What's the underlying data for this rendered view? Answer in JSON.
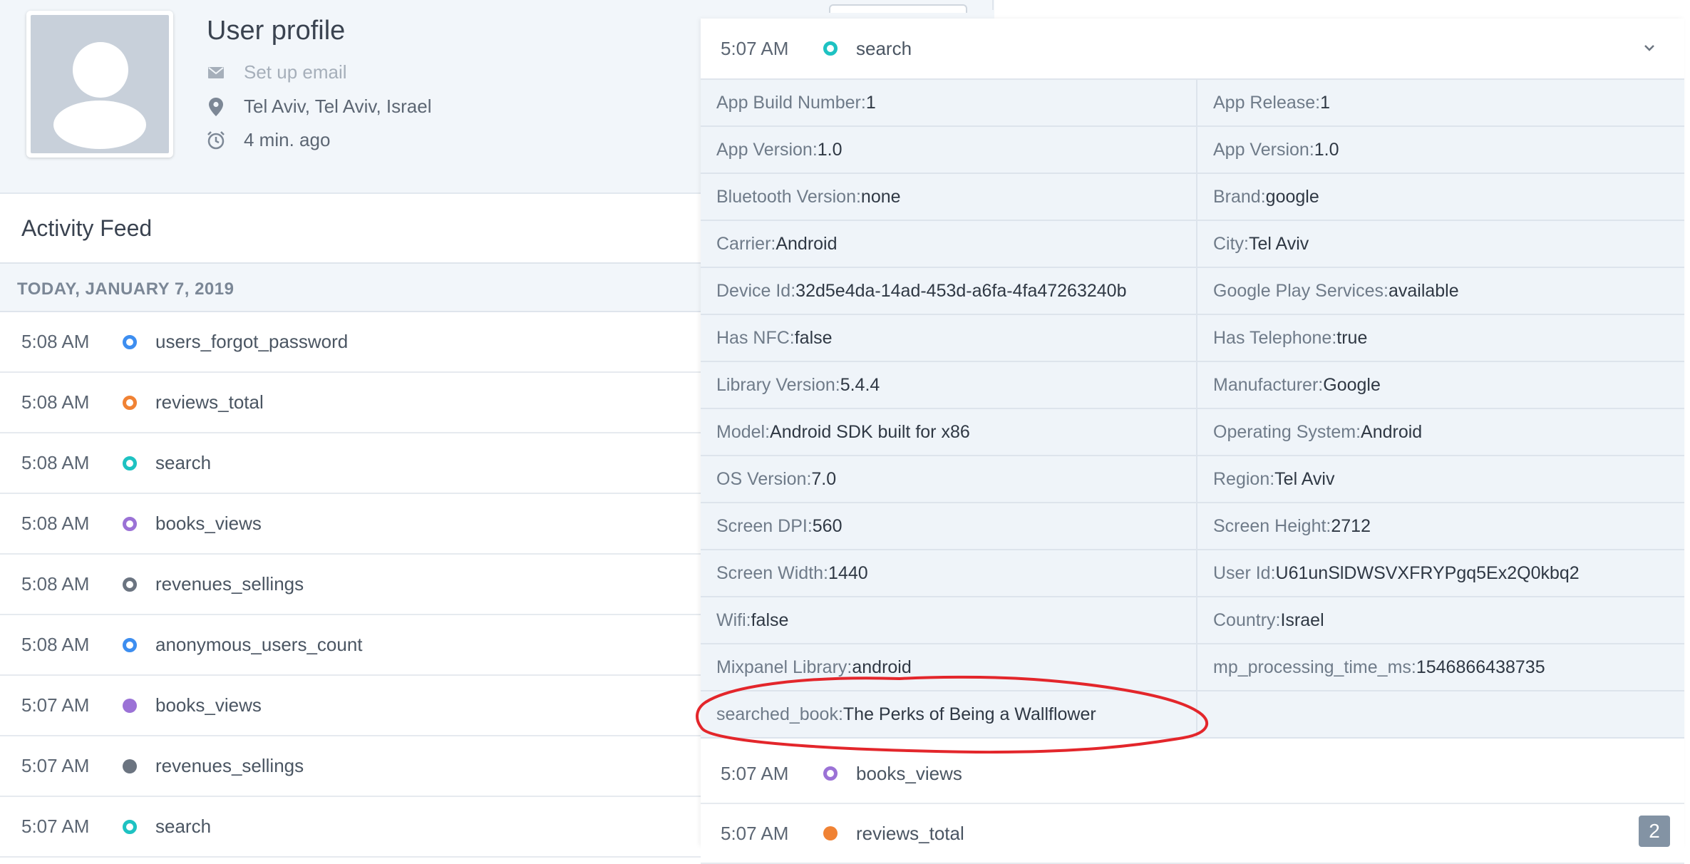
{
  "profile": {
    "title": "User profile",
    "email": "Set up email",
    "location": "Tel Aviv, Tel Aviv, Israel",
    "last_seen": "4 min. ago"
  },
  "feed": {
    "title": "Activity Feed",
    "date": "TODAY, JANUARY 7, 2019",
    "items": [
      {
        "time": "5:08 AM",
        "name": "users_forgot_password",
        "color": "#3d8ef0",
        "ring": true
      },
      {
        "time": "5:08 AM",
        "name": "reviews_total",
        "color": "#f08234",
        "ring": true
      },
      {
        "time": "5:08 AM",
        "name": "search",
        "color": "#1ec2c2",
        "ring": true
      },
      {
        "time": "5:08 AM",
        "name": "books_views",
        "color": "#9b72d6",
        "ring": true
      },
      {
        "time": "5:08 AM",
        "name": "revenues_sellings",
        "color": "#6b7480",
        "ring": true
      },
      {
        "time": "5:08 AM",
        "name": "anonymous_users_count",
        "color": "#3d8ef0",
        "ring": true
      },
      {
        "time": "5:07 AM",
        "name": "books_views",
        "color": "#9b72d6",
        "ring": false
      },
      {
        "time": "5:07 AM",
        "name": "revenues_sellings",
        "color": "#6b7480",
        "ring": false
      },
      {
        "time": "5:07 AM",
        "name": "search",
        "color": "#1ec2c2",
        "ring": true
      }
    ]
  },
  "detail": {
    "header": {
      "time": "5:07 AM",
      "name": "search",
      "color": "#1ec2c2"
    },
    "rows": [
      [
        {
          "k": "App Build Number: ",
          "v": "1"
        },
        {
          "k": "App Release: ",
          "v": "1"
        }
      ],
      [
        {
          "k": "App Version: ",
          "v": "1.0"
        },
        {
          "k": "App Version: ",
          "v": "1.0"
        }
      ],
      [
        {
          "k": "Bluetooth Version: ",
          "v": "none"
        },
        {
          "k": "Brand: ",
          "v": "google"
        }
      ],
      [
        {
          "k": "Carrier: ",
          "v": "Android"
        },
        {
          "k": "City: ",
          "v": "Tel Aviv"
        }
      ],
      [
        {
          "k": "Device Id: ",
          "v": "32d5e4da-14ad-453d-a6fa-4fa47263240b"
        },
        {
          "k": "Google Play Services: ",
          "v": "available"
        }
      ],
      [
        {
          "k": "Has NFC: ",
          "v": "false"
        },
        {
          "k": "Has Telephone: ",
          "v": "true"
        }
      ],
      [
        {
          "k": "Library Version: ",
          "v": "5.4.4"
        },
        {
          "k": "Manufacturer: ",
          "v": "Google"
        }
      ],
      [
        {
          "k": "Model: ",
          "v": "Android SDK built for x86"
        },
        {
          "k": "Operating System: ",
          "v": "Android"
        }
      ],
      [
        {
          "k": "OS Version: ",
          "v": "7.0"
        },
        {
          "k": "Region: ",
          "v": "Tel Aviv"
        }
      ],
      [
        {
          "k": "Screen DPI: ",
          "v": "560"
        },
        {
          "k": "Screen Height: ",
          "v": "2712"
        }
      ],
      [
        {
          "k": "Screen Width: ",
          "v": "1440"
        },
        {
          "k": "User Id: ",
          "v": "U61unSlDWSVXFRYPgq5Ex2Q0kbq2"
        }
      ],
      [
        {
          "k": "Wifi: ",
          "v": "false"
        },
        {
          "k": "Country: ",
          "v": "Israel"
        }
      ],
      [
        {
          "k": "Mixpanel Library: ",
          "v": "android"
        },
        {
          "k": "mp_processing_time_ms: ",
          "v": "1546866438735"
        }
      ],
      [
        {
          "k": "searched_book: ",
          "v": "The Perks of Being a Wallflower"
        },
        {
          "k": "",
          "v": ""
        }
      ]
    ],
    "after": [
      {
        "time": "5:07 AM",
        "name": "books_views",
        "color": "#9b72d6",
        "ring": true
      },
      {
        "time": "5:07 AM",
        "name": "reviews_total",
        "color": "#f08234",
        "ring": false
      }
    ],
    "badge": "2"
  },
  "annotation_color": "#e3262b"
}
